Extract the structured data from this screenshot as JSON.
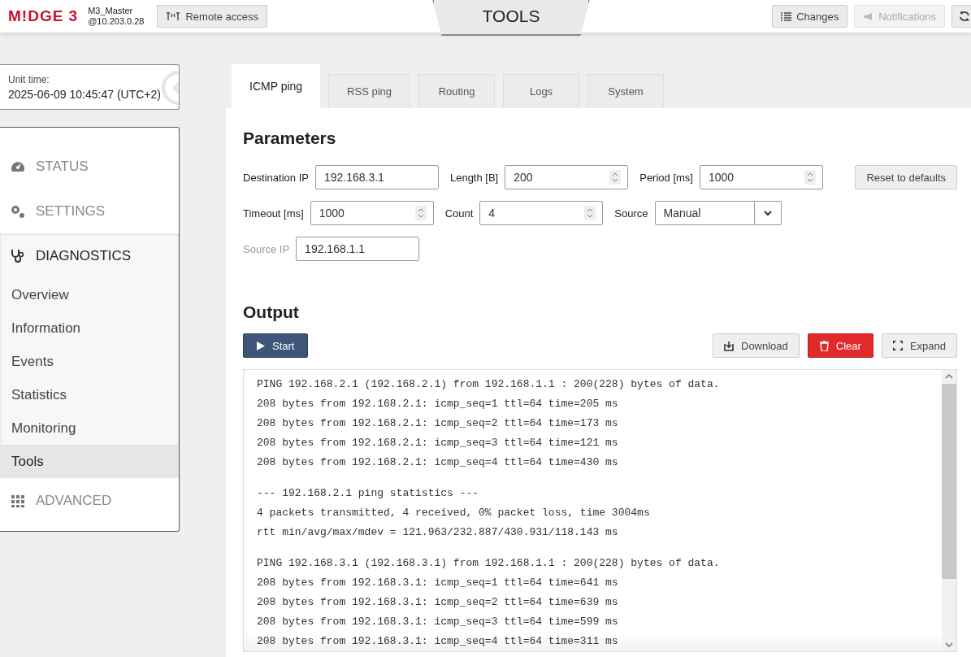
{
  "header": {
    "logo": "M!DGE 3",
    "unit_name": "M3_Master",
    "unit_address": "@10.203.0.28",
    "remote_button": "Remote access",
    "page_title": "TOOLS",
    "buttons": [
      {
        "label": "Changes",
        "disabled": false
      },
      {
        "label": "Notifications",
        "disabled": true
      }
    ]
  },
  "unit_time": {
    "label": "Unit time:",
    "value": "2025-06-09 10:45:47 (UTC+2)"
  },
  "sidebar": {
    "items": [
      {
        "label": "STATUS",
        "selected": false,
        "expanded": false
      },
      {
        "label": "SETTINGS",
        "selected": false,
        "expanded": false
      },
      {
        "label": "DIAGNOSTICS",
        "selected": true,
        "expanded": true,
        "children": [
          {
            "label": "Overview",
            "selected": false
          },
          {
            "label": "Information",
            "selected": false
          },
          {
            "label": "Events",
            "selected": false
          },
          {
            "label": "Statistics",
            "selected": false
          },
          {
            "label": "Monitoring",
            "selected": false
          },
          {
            "label": "Tools",
            "selected": true
          }
        ]
      },
      {
        "label": "ADVANCED",
        "selected": false,
        "expanded": false
      }
    ]
  },
  "tabs": [
    {
      "label": "ICMP ping",
      "selected": true
    },
    {
      "label": "RSS ping",
      "selected": false
    },
    {
      "label": "Routing",
      "selected": false
    },
    {
      "label": "Logs",
      "selected": false
    },
    {
      "label": "System",
      "selected": false
    }
  ],
  "parameters": {
    "title": "Parameters",
    "reset_button": "Reset to defaults",
    "rows": [
      [
        {
          "label": "Destination IP",
          "kind": "text",
          "value": "192.168.3.1",
          "disabled": false
        },
        {
          "label": "Length [B]",
          "kind": "number",
          "value": "200",
          "disabled": false
        },
        {
          "label": "Period [ms]",
          "kind": "number",
          "value": "1000",
          "disabled": false
        }
      ],
      [
        {
          "label": "Timeout [ms]",
          "kind": "number",
          "value": "1000",
          "disabled": false
        },
        {
          "label": "Count",
          "kind": "number",
          "value": "4",
          "disabled": false
        },
        {
          "label": "Source",
          "kind": "select",
          "value": "Manual",
          "disabled": false
        }
      ],
      [
        {
          "label": "Source IP",
          "kind": "text",
          "value": "192.168.1.1",
          "disabled": true
        }
      ]
    ]
  },
  "output": {
    "title": "Output",
    "start_button": "Start",
    "download_button": "Download",
    "clear_button": "Clear",
    "expand_button": "Expand",
    "groups": [
      [
        "PING 192.168.2.1 (192.168.2.1) from 192.168.1.1 : 200(228) bytes of data.",
        "208 bytes from 192.168.2.1: icmp_seq=1 ttl=64 time=205 ms",
        "208 bytes from 192.168.2.1: icmp_seq=2 ttl=64 time=173 ms",
        "208 bytes from 192.168.2.1: icmp_seq=3 ttl=64 time=121 ms",
        "208 bytes from 192.168.2.1: icmp_seq=4 ttl=64 time=430 ms"
      ],
      [
        "--- 192.168.2.1 ping statistics ---",
        "4 packets transmitted, 4 received, 0% packet loss, time 3004ms",
        "rtt min/avg/max/mdev = 121.963/232.887/430.931/118.143 ms"
      ],
      [
        "PING 192.168.3.1 (192.168.3.1) from 192.168.1.1 : 200(228) bytes of data.",
        "208 bytes from 192.168.3.1: icmp_seq=1 ttl=64 time=641 ms",
        "208 bytes from 192.168.3.1: icmp_seq=2 ttl=64 time=639 ms",
        "208 bytes from 192.168.3.1: icmp_seq=3 ttl=64 time=599 ms",
        "208 bytes from 192.168.3.1: icmp_seq=4 ttl=64 time=311 ms"
      ]
    ]
  }
}
